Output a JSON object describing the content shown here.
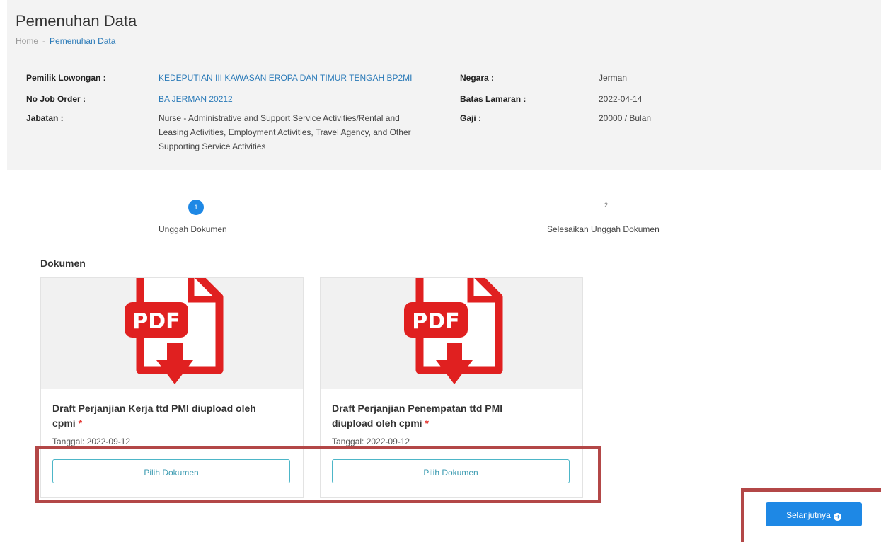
{
  "page": {
    "title": "Pemenuhan Data",
    "breadcrumb": {
      "home": "Home",
      "separator": "-",
      "current": "Pemenuhan Data"
    }
  },
  "job_info": {
    "left": [
      {
        "label": "Pemilik Lowongan :",
        "value": "KEDEPUTIAN III KAWASAN EROPA DAN TIMUR TENGAH BP2MI"
      },
      {
        "label": "No Job Order :",
        "value": "BA JERMAN 20212"
      },
      {
        "label": "Jabatan :",
        "value_lines": [
          "Nurse - Administrative and Support Service Activities/Rental and",
          "Leasing Activities, Employment Activities, Travel Agency, and Other",
          "Supporting Service Activities"
        ]
      }
    ],
    "right": [
      {
        "label": "Negara :",
        "value": "Jerman"
      },
      {
        "label": "Batas Lamaran :",
        "value": "2022-04-14"
      },
      {
        "label": "Gaji :",
        "value": "20000 / Bulan"
      }
    ]
  },
  "stepper": {
    "steps": [
      {
        "number": "1",
        "label": "Unggah Dokumen",
        "active": true
      },
      {
        "number": "2",
        "label": "Selesaikan Unggah Dokumen",
        "active": false
      }
    ]
  },
  "documents": {
    "section_title": "Dokumen",
    "items": [
      {
        "title_lines": [
          "Draft Perjanjian Kerja ttd PMI diupload oleh",
          "cpmi"
        ],
        "required_mark": "*",
        "date": "Tanggal: 2022-09-12",
        "button": "Pilih Dokumen",
        "icon": "pdf-download-icon",
        "icon_text": "PDF"
      },
      {
        "title_lines": [
          "Draft Perjanjian Penempatan ttd PMI",
          "diupload oleh cpmi"
        ],
        "required_mark": "*",
        "date": "Tanggal: 2022-09-12",
        "button": "Pilih Dokumen",
        "icon": "pdf-download-icon",
        "icon_text": "PDF"
      }
    ]
  },
  "actions": {
    "next_label": "Selanjutnya",
    "next_icon": "arrow-circle-right-icon"
  },
  "colors": {
    "primary": "#1e88e5",
    "link": "#2a7ab8",
    "highlight": "#b34747",
    "pdf_red": "#e02020",
    "outline_button": "#4db6c8"
  }
}
